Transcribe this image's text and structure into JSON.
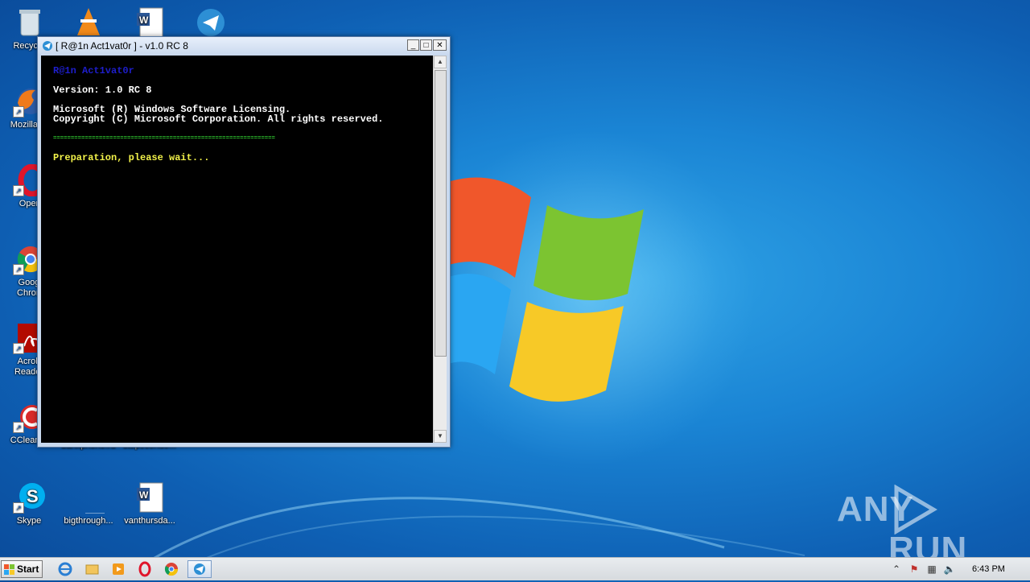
{
  "desktop": {
    "icons": [
      {
        "id": "recycle",
        "label": "Recycle"
      },
      {
        "id": "vlc",
        "label": ""
      },
      {
        "id": "word1",
        "label": ""
      },
      {
        "id": "tool",
        "label": ""
      },
      {
        "id": "firefox",
        "label": "Mozilla Fi"
      },
      {
        "id": "opera",
        "label": "Oper"
      },
      {
        "id": "chrome",
        "label": "Goog Chron"
      },
      {
        "id": "acrobat",
        "label": "Acrob Reader"
      },
      {
        "id": "ccleaner",
        "label": "CCleaner"
      },
      {
        "id": "bankphone",
        "label": "bankphone.ru"
      },
      {
        "id": "stepecondo",
        "label": "stepecondo..."
      },
      {
        "id": "skype",
        "label": "Skype"
      },
      {
        "id": "bigthrough",
        "label": "bigthrough..."
      },
      {
        "id": "vanthursda",
        "label": "vanthursda..."
      }
    ]
  },
  "console_window": {
    "title": "[ R@1n Act1vat0r ] - v1.0 RC 8",
    "buttons": {
      "minimize": "_",
      "maximize": "□",
      "close": "✕"
    },
    "lines": {
      "app_name": "R@1n Act1vat0r",
      "version": "Version: 1.0 RC 8",
      "licensing": "Microsoft (R) Windows Software Licensing.",
      "copyright": "Copyright (C) Microsoft Corporation. All rights reserved.",
      "separator": "===============================================================",
      "status": "Preparation, please wait..."
    },
    "colors": {
      "app_name": "#1e1ecc",
      "text": "#ffffff",
      "separator": "#33d633",
      "status": "#f2f24a"
    }
  },
  "watermark": {
    "left": "ANY",
    "right": "RUN"
  },
  "taskbar": {
    "start_label": "Start",
    "items": [
      "ie-icon",
      "explorer-icon",
      "media-player-icon",
      "opera-icon",
      "chrome-icon",
      "activator-icon"
    ],
    "clock": "6:43 PM"
  }
}
